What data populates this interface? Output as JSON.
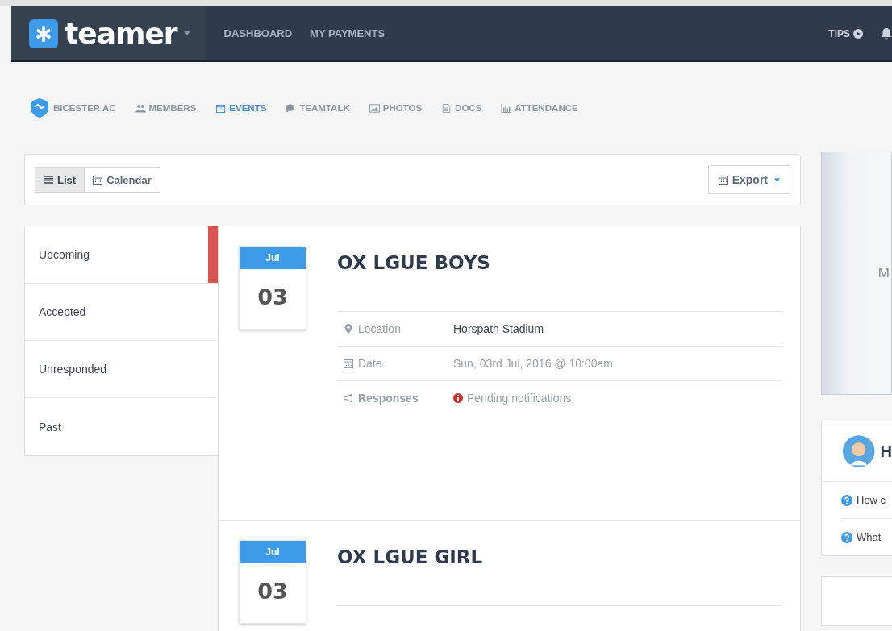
{
  "topbar": {
    "logo": "teamer",
    "nav": [
      {
        "label": "DASHBOARD"
      },
      {
        "label": "MY PAYMENTS"
      }
    ],
    "tips": "TIPS"
  },
  "subnav": {
    "team": "BICESTER AC",
    "items": [
      {
        "label": "MEMBERS",
        "kind": "members",
        "selected": false
      },
      {
        "label": "EVENTS",
        "kind": "events",
        "selected": true
      },
      {
        "label": "TEAMTALK",
        "kind": "teamtalk",
        "selected": false
      },
      {
        "label": "PHOTOS",
        "kind": "photos",
        "selected": false
      },
      {
        "label": "DOCS",
        "kind": "docs",
        "selected": false
      },
      {
        "label": "ATTENDANCE",
        "kind": "attendance",
        "selected": false
      }
    ]
  },
  "toolbar": {
    "views": [
      {
        "label": "List",
        "kind": "list",
        "selected": true
      },
      {
        "label": "Calendar",
        "kind": "calendar",
        "selected": false
      }
    ],
    "export": "Export"
  },
  "filters": [
    {
      "label": "Upcoming",
      "selected": true
    },
    {
      "label": "Accepted",
      "selected": false
    },
    {
      "label": "Unresponded",
      "selected": false
    },
    {
      "label": "Past",
      "selected": false
    }
  ],
  "events": [
    {
      "month": "Jul",
      "day": "03",
      "title": "OX LGUE BOYS",
      "details": [
        {
          "kind": "location",
          "label": "Location",
          "value": "Horspath Stadium"
        },
        {
          "kind": "date",
          "label": "Date",
          "value": "Sun, 03rd Jul, 2016 @ 10:00am"
        },
        {
          "kind": "responses",
          "label": "Responses",
          "value": "Pending notifications"
        }
      ]
    },
    {
      "month": "Jul",
      "day": "03",
      "title": "OX LGUE GIRL"
    }
  ],
  "side": {
    "promo_text": "M",
    "help_title": "H",
    "help_items": [
      "How c",
      "What"
    ]
  }
}
